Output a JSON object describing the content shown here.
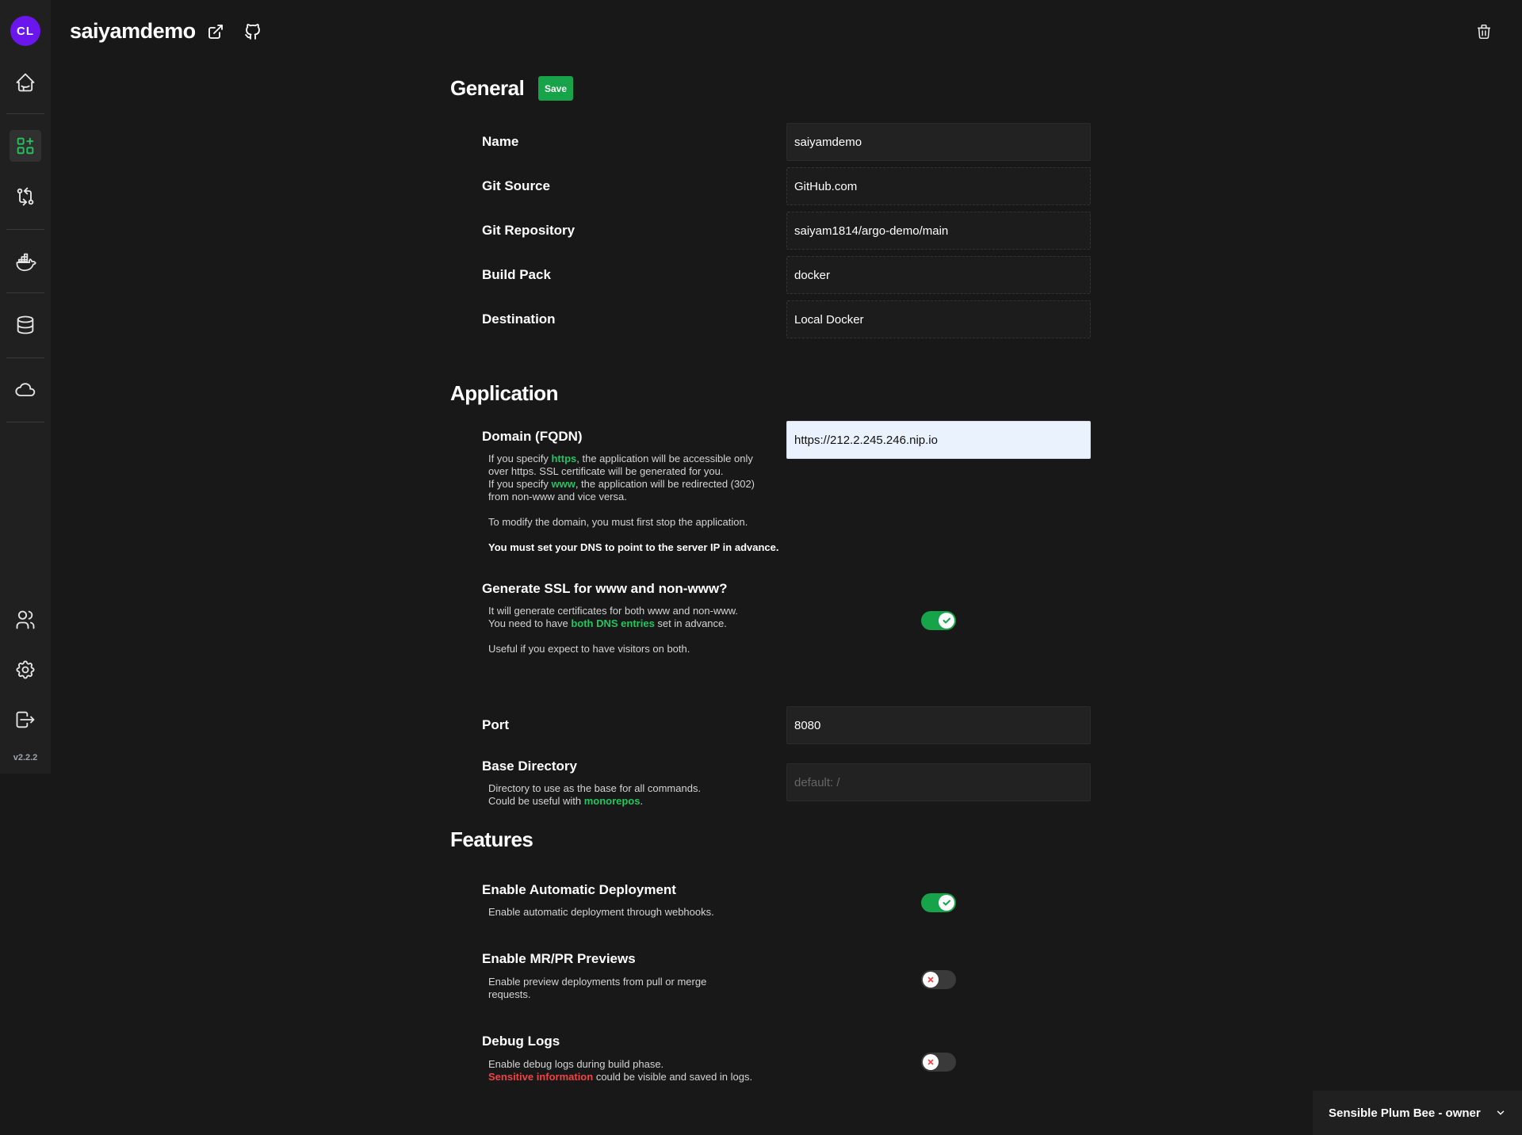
{
  "sidebar": {
    "logo_text": "CL",
    "version": "v2.2.2",
    "items": [
      {
        "name": "home",
        "icon": "home-icon"
      },
      {
        "name": "applications",
        "icon": "apps-icon",
        "active": true
      },
      {
        "name": "git-sources",
        "icon": "git-compare-icon"
      },
      {
        "name": "destinations",
        "icon": "docker-icon"
      },
      {
        "name": "databases",
        "icon": "database-icon"
      },
      {
        "name": "services",
        "icon": "cloud-icon"
      },
      {
        "name": "teams",
        "icon": "users-icon"
      },
      {
        "name": "settings",
        "icon": "gear-icon"
      },
      {
        "name": "logout",
        "icon": "logout-icon"
      }
    ]
  },
  "header": {
    "title": "saiyamdemo"
  },
  "general": {
    "title": "General",
    "save_label": "Save",
    "fields": {
      "name": {
        "label": "Name",
        "value": "saiyamdemo"
      },
      "git_source": {
        "label": "Git Source",
        "value": "GitHub.com"
      },
      "git_repository": {
        "label": "Git Repository",
        "value": "saiyam1814/argo-demo/main"
      },
      "build_pack": {
        "label": "Build Pack",
        "value": "docker"
      },
      "destination": {
        "label": "Destination",
        "value": "Local Docker"
      }
    }
  },
  "application": {
    "title": "Application",
    "domain": {
      "label": "Domain (FQDN)",
      "value": "https://212.2.245.246.nip.io",
      "help1_pre": "If you specify ",
      "help1_hl": "https",
      "help1_post": ", the application will be accessible only",
      "help2": "over https. SSL certificate will be generated for you.",
      "help3_pre": "If you specify ",
      "help3_hl": "www",
      "help3_post": ", the application will be redirected (302)",
      "help4": "from non-www and vice versa.",
      "help5": "To modify the domain, you must first stop the application.",
      "help6": "You must set your DNS to point to the server IP in advance."
    },
    "ssl": {
      "label": "Generate SSL for www and non-www?",
      "help1": "It will generate certificates for both www and non-www.",
      "help2_pre": "You need to have ",
      "help2_hl": "both DNS entries",
      "help2_post": " set in advance.",
      "help3": "Useful if you expect to have visitors on both.",
      "enabled": true
    },
    "port": {
      "label": "Port",
      "value": "8080"
    },
    "base_directory": {
      "label": "Base Directory",
      "placeholder": "default: /",
      "help1": "Directory to use as the base for all commands.",
      "help2_pre": "Could be useful with ",
      "help2_hl": "monorepos",
      "help2_post": "."
    }
  },
  "features": {
    "title": "Features",
    "auto_deploy": {
      "label": "Enable Automatic Deployment",
      "help": "Enable automatic deployment through webhooks.",
      "enabled": true
    },
    "previews": {
      "label": "Enable MR/PR Previews",
      "help1": "Enable preview deployments from pull or merge",
      "help2": "requests.",
      "enabled": false
    },
    "debug_logs": {
      "label": "Debug Logs",
      "help1": "Enable debug logs during build phase.",
      "help2_hl": "Sensitive information",
      "help2_post": " could be visible and saved in logs.",
      "enabled": false
    }
  },
  "team_selector": {
    "value": "Sensible Plum Bee - owner"
  },
  "colors": {
    "accent_green": "#16a34a",
    "logo_purple": "#6b16ed",
    "danger_red": "#ef4444"
  }
}
